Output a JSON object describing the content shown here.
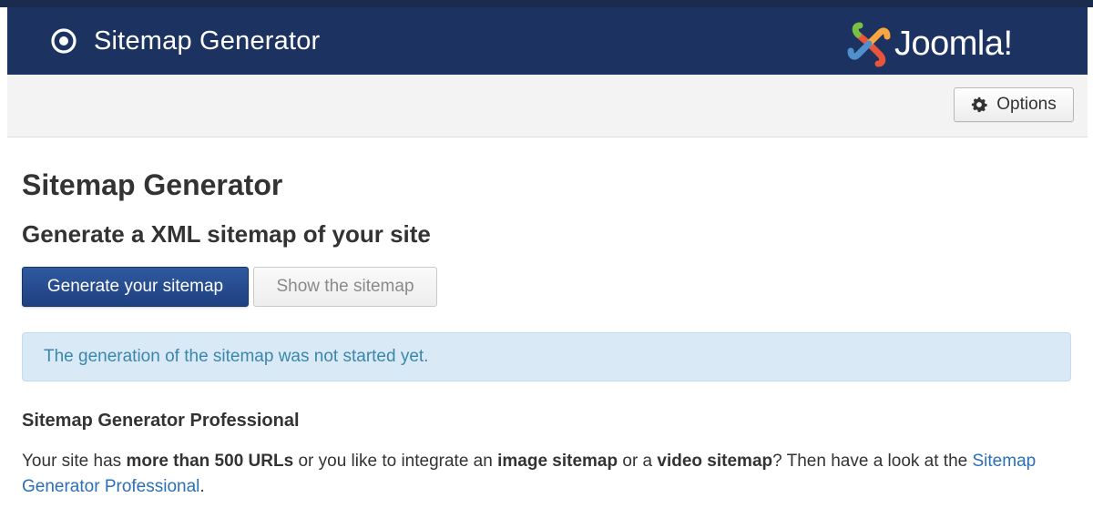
{
  "header": {
    "title": "Sitemap Generator",
    "logo_text": "Joomla!",
    "icon": "target-circle-icon",
    "background": "#1c3361"
  },
  "toolbar": {
    "options_label": "Options",
    "options_icon": "gear-icon"
  },
  "main": {
    "page_title": "Sitemap Generator",
    "subtitle": "Generate a XML sitemap of your site",
    "generate_button": "Generate your sitemap",
    "show_button": "Show the sitemap",
    "status_message": "The generation of the sitemap was not started yet.",
    "pro_heading": "Sitemap Generator Professional",
    "pro_text": {
      "part1": "Your site has ",
      "bold1": "more than 500 URLs",
      "part2": " or you like to integrate an ",
      "bold2": "image sitemap",
      "part3": " or a ",
      "bold3": "video sitemap",
      "part4": "? Then have a look at the ",
      "link": "Sitemap Generator Professional",
      "part5": "."
    }
  },
  "colors": {
    "primary": "#1e4080",
    "info_bg": "#d9e9f6",
    "info_text": "#3a87ad",
    "link": "#2a6fb7"
  }
}
